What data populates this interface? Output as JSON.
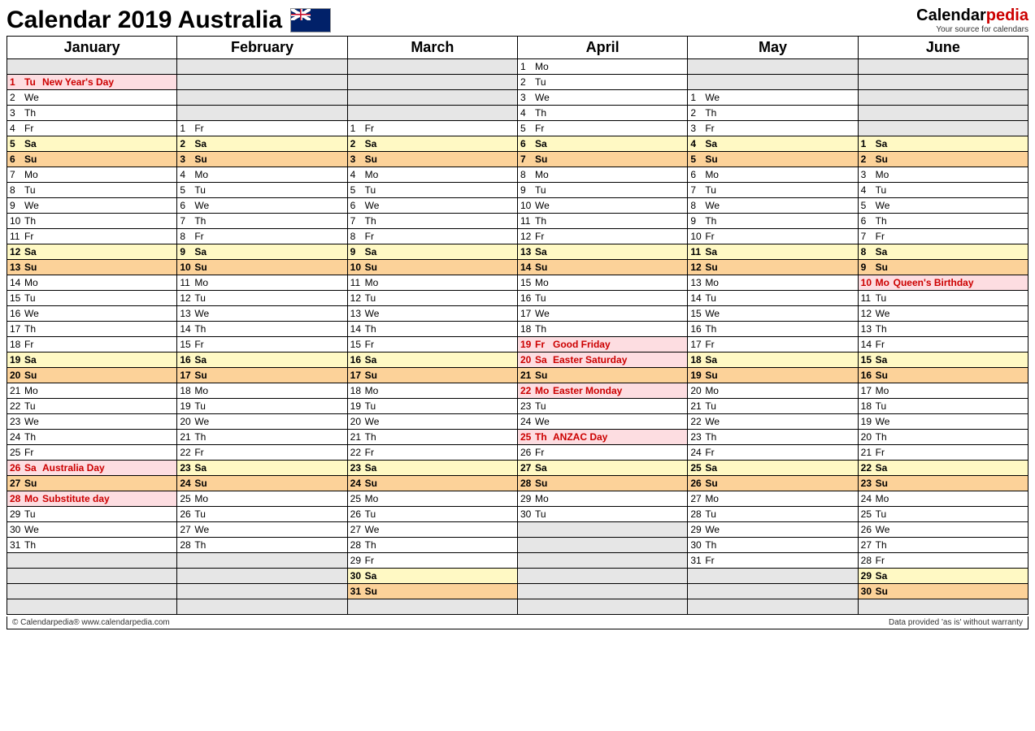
{
  "title": "Calendar 2019 Australia",
  "brand": {
    "part1": "Calendar",
    "part2": "pedia",
    "tag": "Your source for calendars"
  },
  "footer": {
    "left": "© Calendarpedia®   www.calendarpedia.com",
    "right": "Data provided 'as is' without warranty"
  },
  "months": [
    "January",
    "February",
    "March",
    "April",
    "May",
    "June"
  ],
  "rows": 36,
  "days": {
    "January": [
      {
        "n": 1,
        "w": "Tu",
        "e": "New Year's Day",
        "h": true
      },
      {
        "n": 2,
        "w": "We"
      },
      {
        "n": 3,
        "w": "Th"
      },
      {
        "n": 4,
        "w": "Fr"
      },
      {
        "n": 5,
        "w": "Sa"
      },
      {
        "n": 6,
        "w": "Su"
      },
      {
        "n": 7,
        "w": "Mo"
      },
      {
        "n": 8,
        "w": "Tu"
      },
      {
        "n": 9,
        "w": "We"
      },
      {
        "n": 10,
        "w": "Th"
      },
      {
        "n": 11,
        "w": "Fr"
      },
      {
        "n": 12,
        "w": "Sa"
      },
      {
        "n": 13,
        "w": "Su"
      },
      {
        "n": 14,
        "w": "Mo"
      },
      {
        "n": 15,
        "w": "Tu"
      },
      {
        "n": 16,
        "w": "We"
      },
      {
        "n": 17,
        "w": "Th"
      },
      {
        "n": 18,
        "w": "Fr"
      },
      {
        "n": 19,
        "w": "Sa"
      },
      {
        "n": 20,
        "w": "Su"
      },
      {
        "n": 21,
        "w": "Mo"
      },
      {
        "n": 22,
        "w": "Tu"
      },
      {
        "n": 23,
        "w": "We"
      },
      {
        "n": 24,
        "w": "Th"
      },
      {
        "n": 25,
        "w": "Fr"
      },
      {
        "n": 26,
        "w": "Sa",
        "e": "Australia Day",
        "h": true
      },
      {
        "n": 27,
        "w": "Su"
      },
      {
        "n": 28,
        "w": "Mo",
        "e": "Substitute day",
        "h": true
      },
      {
        "n": 29,
        "w": "Tu"
      },
      {
        "n": 30,
        "w": "We"
      },
      {
        "n": 31,
        "w": "Th"
      }
    ],
    "February": [
      {
        "n": 1,
        "w": "Fr"
      },
      {
        "n": 2,
        "w": "Sa"
      },
      {
        "n": 3,
        "w": "Su"
      },
      {
        "n": 4,
        "w": "Mo"
      },
      {
        "n": 5,
        "w": "Tu"
      },
      {
        "n": 6,
        "w": "We"
      },
      {
        "n": 7,
        "w": "Th"
      },
      {
        "n": 8,
        "w": "Fr"
      },
      {
        "n": 9,
        "w": "Sa"
      },
      {
        "n": 10,
        "w": "Su"
      },
      {
        "n": 11,
        "w": "Mo"
      },
      {
        "n": 12,
        "w": "Tu"
      },
      {
        "n": 13,
        "w": "We"
      },
      {
        "n": 14,
        "w": "Th"
      },
      {
        "n": 15,
        "w": "Fr"
      },
      {
        "n": 16,
        "w": "Sa"
      },
      {
        "n": 17,
        "w": "Su"
      },
      {
        "n": 18,
        "w": "Mo"
      },
      {
        "n": 19,
        "w": "Tu"
      },
      {
        "n": 20,
        "w": "We"
      },
      {
        "n": 21,
        "w": "Th"
      },
      {
        "n": 22,
        "w": "Fr"
      },
      {
        "n": 23,
        "w": "Sa"
      },
      {
        "n": 24,
        "w": "Su"
      },
      {
        "n": 25,
        "w": "Mo"
      },
      {
        "n": 26,
        "w": "Tu"
      },
      {
        "n": 27,
        "w": "We"
      },
      {
        "n": 28,
        "w": "Th"
      }
    ],
    "March": [
      {
        "n": 1,
        "w": "Fr"
      },
      {
        "n": 2,
        "w": "Sa"
      },
      {
        "n": 3,
        "w": "Su"
      },
      {
        "n": 4,
        "w": "Mo"
      },
      {
        "n": 5,
        "w": "Tu"
      },
      {
        "n": 6,
        "w": "We"
      },
      {
        "n": 7,
        "w": "Th"
      },
      {
        "n": 8,
        "w": "Fr"
      },
      {
        "n": 9,
        "w": "Sa"
      },
      {
        "n": 10,
        "w": "Su"
      },
      {
        "n": 11,
        "w": "Mo"
      },
      {
        "n": 12,
        "w": "Tu"
      },
      {
        "n": 13,
        "w": "We"
      },
      {
        "n": 14,
        "w": "Th"
      },
      {
        "n": 15,
        "w": "Fr"
      },
      {
        "n": 16,
        "w": "Sa"
      },
      {
        "n": 17,
        "w": "Su"
      },
      {
        "n": 18,
        "w": "Mo"
      },
      {
        "n": 19,
        "w": "Tu"
      },
      {
        "n": 20,
        "w": "We"
      },
      {
        "n": 21,
        "w": "Th"
      },
      {
        "n": 22,
        "w": "Fr"
      },
      {
        "n": 23,
        "w": "Sa"
      },
      {
        "n": 24,
        "w": "Su"
      },
      {
        "n": 25,
        "w": "Mo"
      },
      {
        "n": 26,
        "w": "Tu"
      },
      {
        "n": 27,
        "w": "We"
      },
      {
        "n": 28,
        "w": "Th"
      },
      {
        "n": 29,
        "w": "Fr"
      },
      {
        "n": 30,
        "w": "Sa"
      },
      {
        "n": 31,
        "w": "Su"
      }
    ],
    "April": [
      {
        "n": 1,
        "w": "Mo"
      },
      {
        "n": 2,
        "w": "Tu"
      },
      {
        "n": 3,
        "w": "We"
      },
      {
        "n": 4,
        "w": "Th"
      },
      {
        "n": 5,
        "w": "Fr"
      },
      {
        "n": 6,
        "w": "Sa"
      },
      {
        "n": 7,
        "w": "Su"
      },
      {
        "n": 8,
        "w": "Mo"
      },
      {
        "n": 9,
        "w": "Tu"
      },
      {
        "n": 10,
        "w": "We"
      },
      {
        "n": 11,
        "w": "Th"
      },
      {
        "n": 12,
        "w": "Fr"
      },
      {
        "n": 13,
        "w": "Sa"
      },
      {
        "n": 14,
        "w": "Su"
      },
      {
        "n": 15,
        "w": "Mo"
      },
      {
        "n": 16,
        "w": "Tu"
      },
      {
        "n": 17,
        "w": "We"
      },
      {
        "n": 18,
        "w": "Th"
      },
      {
        "n": 19,
        "w": "Fr",
        "e": "Good Friday",
        "h": true
      },
      {
        "n": 20,
        "w": "Sa",
        "e": "Easter Saturday",
        "h": true
      },
      {
        "n": 21,
        "w": "Su"
      },
      {
        "n": 22,
        "w": "Mo",
        "e": "Easter Monday",
        "h": true
      },
      {
        "n": 23,
        "w": "Tu"
      },
      {
        "n": 24,
        "w": "We"
      },
      {
        "n": 25,
        "w": "Th",
        "e": "ANZAC Day",
        "h": true
      },
      {
        "n": 26,
        "w": "Fr"
      },
      {
        "n": 27,
        "w": "Sa"
      },
      {
        "n": 28,
        "w": "Su"
      },
      {
        "n": 29,
        "w": "Mo"
      },
      {
        "n": 30,
        "w": "Tu"
      }
    ],
    "May": [
      {
        "n": 1,
        "w": "We"
      },
      {
        "n": 2,
        "w": "Th"
      },
      {
        "n": 3,
        "w": "Fr"
      },
      {
        "n": 4,
        "w": "Sa"
      },
      {
        "n": 5,
        "w": "Su"
      },
      {
        "n": 6,
        "w": "Mo"
      },
      {
        "n": 7,
        "w": "Tu"
      },
      {
        "n": 8,
        "w": "We"
      },
      {
        "n": 9,
        "w": "Th"
      },
      {
        "n": 10,
        "w": "Fr"
      },
      {
        "n": 11,
        "w": "Sa"
      },
      {
        "n": 12,
        "w": "Su"
      },
      {
        "n": 13,
        "w": "Mo"
      },
      {
        "n": 14,
        "w": "Tu"
      },
      {
        "n": 15,
        "w": "We"
      },
      {
        "n": 16,
        "w": "Th"
      },
      {
        "n": 17,
        "w": "Fr"
      },
      {
        "n": 18,
        "w": "Sa"
      },
      {
        "n": 19,
        "w": "Su"
      },
      {
        "n": 20,
        "w": "Mo"
      },
      {
        "n": 21,
        "w": "Tu"
      },
      {
        "n": 22,
        "w": "We"
      },
      {
        "n": 23,
        "w": "Th"
      },
      {
        "n": 24,
        "w": "Fr"
      },
      {
        "n": 25,
        "w": "Sa"
      },
      {
        "n": 26,
        "w": "Su"
      },
      {
        "n": 27,
        "w": "Mo"
      },
      {
        "n": 28,
        "w": "Tu"
      },
      {
        "n": 29,
        "w": "We"
      },
      {
        "n": 30,
        "w": "Th"
      },
      {
        "n": 31,
        "w": "Fr"
      }
    ],
    "June": [
      {
        "n": 1,
        "w": "Sa"
      },
      {
        "n": 2,
        "w": "Su"
      },
      {
        "n": 3,
        "w": "Mo"
      },
      {
        "n": 4,
        "w": "Tu"
      },
      {
        "n": 5,
        "w": "We"
      },
      {
        "n": 6,
        "w": "Th"
      },
      {
        "n": 7,
        "w": "Fr"
      },
      {
        "n": 8,
        "w": "Sa"
      },
      {
        "n": 9,
        "w": "Su"
      },
      {
        "n": 10,
        "w": "Mo",
        "e": "Queen's Birthday",
        "h": true
      },
      {
        "n": 11,
        "w": "Tu"
      },
      {
        "n": 12,
        "w": "We"
      },
      {
        "n": 13,
        "w": "Th"
      },
      {
        "n": 14,
        "w": "Fr"
      },
      {
        "n": 15,
        "w": "Sa"
      },
      {
        "n": 16,
        "w": "Su"
      },
      {
        "n": 17,
        "w": "Mo"
      },
      {
        "n": 18,
        "w": "Tu"
      },
      {
        "n": 19,
        "w": "We"
      },
      {
        "n": 20,
        "w": "Th"
      },
      {
        "n": 21,
        "w": "Fr"
      },
      {
        "n": 22,
        "w": "Sa"
      },
      {
        "n": 23,
        "w": "Su"
      },
      {
        "n": 24,
        "w": "Mo"
      },
      {
        "n": 25,
        "w": "Tu"
      },
      {
        "n": 26,
        "w": "We"
      },
      {
        "n": 27,
        "w": "Th"
      },
      {
        "n": 28,
        "w": "Fr"
      },
      {
        "n": 29,
        "w": "Sa"
      },
      {
        "n": 30,
        "w": "Su"
      }
    ]
  },
  "offset": {
    "January": 1,
    "February": 4,
    "March": 4,
    "April": 0,
    "May": 2,
    "June": 5
  }
}
